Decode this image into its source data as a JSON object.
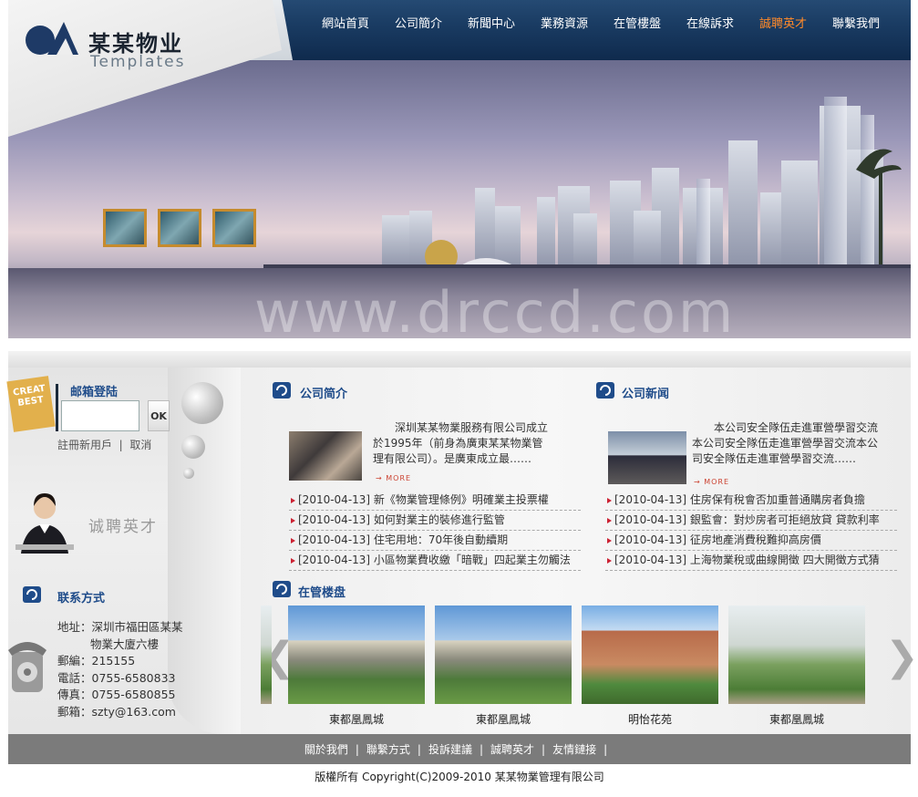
{
  "brand": {
    "name_cn": "某某物业",
    "name_en": "Templates"
  },
  "nav": [
    {
      "label": "網站首頁",
      "active": false
    },
    {
      "label": "公司簡介",
      "active": false
    },
    {
      "label": "新聞中心",
      "active": false
    },
    {
      "label": "業務資源",
      "active": false
    },
    {
      "label": "在管樓盤",
      "active": false
    },
    {
      "label": "在線訴求",
      "active": false
    },
    {
      "label": "誠聘英才",
      "active": true
    },
    {
      "label": "聯繫我們",
      "active": false
    }
  ],
  "banner": {
    "watermark": "www.drccd.com"
  },
  "login": {
    "stamp": "CREAT BEST",
    "title": "邮箱登陆",
    "ok": "OK",
    "register": "註冊新用戶",
    "separator": "|",
    "cancel": "取消"
  },
  "recruit": {
    "label": "诚聘英才"
  },
  "contact": {
    "title": "联系方式",
    "address_label": "地址：",
    "address_line1": "深圳市福田區某某",
    "address_line2": "物業大廈六樓",
    "postcode": "郵編：215155",
    "phone": "電話：0755-6580833",
    "fax": "傳真：0755-6580855",
    "email": "郵箱：szty@163.com"
  },
  "intro": {
    "title": "公司简介",
    "text": "深圳某某物業服務有限公司成立於1995年（前身為廣東某某物業管理有限公司）。是廣東成立最……",
    "more": "MORE",
    "news": [
      "[2010-04-13]  新《物業管理條例》明確業主投票權",
      "[2010-04-13]  如何對業主的裝修進行監管",
      "[2010-04-13]  住宅用地：70年後自動續期",
      "[2010-04-13]  小區物業費收繳「暗戰」四起業主勿觸法"
    ]
  },
  "company_news": {
    "title": "公司新闻",
    "text": "本公司安全隊伍走進軍營學習交流本公司安全隊伍走進軍營學習交流本公司安全隊伍走進軍營學習交流……",
    "more": "MORE",
    "news": [
      "[2010-04-13]  住房保有稅會否加重普通購房者負擔",
      "[2010-04-13]  銀監會：對炒房者可拒絕放貸 貸款利率",
      "[2010-04-13]  征房地產消費稅難抑高房價",
      "[2010-04-13]  上海物業稅或曲線開徵 四大開徵方式猜"
    ]
  },
  "properties": {
    "title": "在管楼盘",
    "prev": "❮",
    "next": "❯",
    "items": [
      {
        "name": "東都凰鳳城"
      },
      {
        "name": "東都凰鳳城"
      },
      {
        "name": "明怡花苑"
      },
      {
        "name": "東都凰鳳城"
      }
    ]
  },
  "footer": {
    "links": [
      "關於我們",
      "聯繫方式",
      "投訴建議",
      "誠聘英才",
      "友情鏈接"
    ],
    "separator": "|",
    "copyright": "版權所有 Copyright(C)2009-2010 某某物業管理有限公司"
  },
  "colors": {
    "nav_bg": "#1a3c63",
    "nav_active": "#ff8a2a",
    "heading": "#1f4c8a",
    "bullet": "#cc2233",
    "footer_bg": "#7b7b7b"
  }
}
